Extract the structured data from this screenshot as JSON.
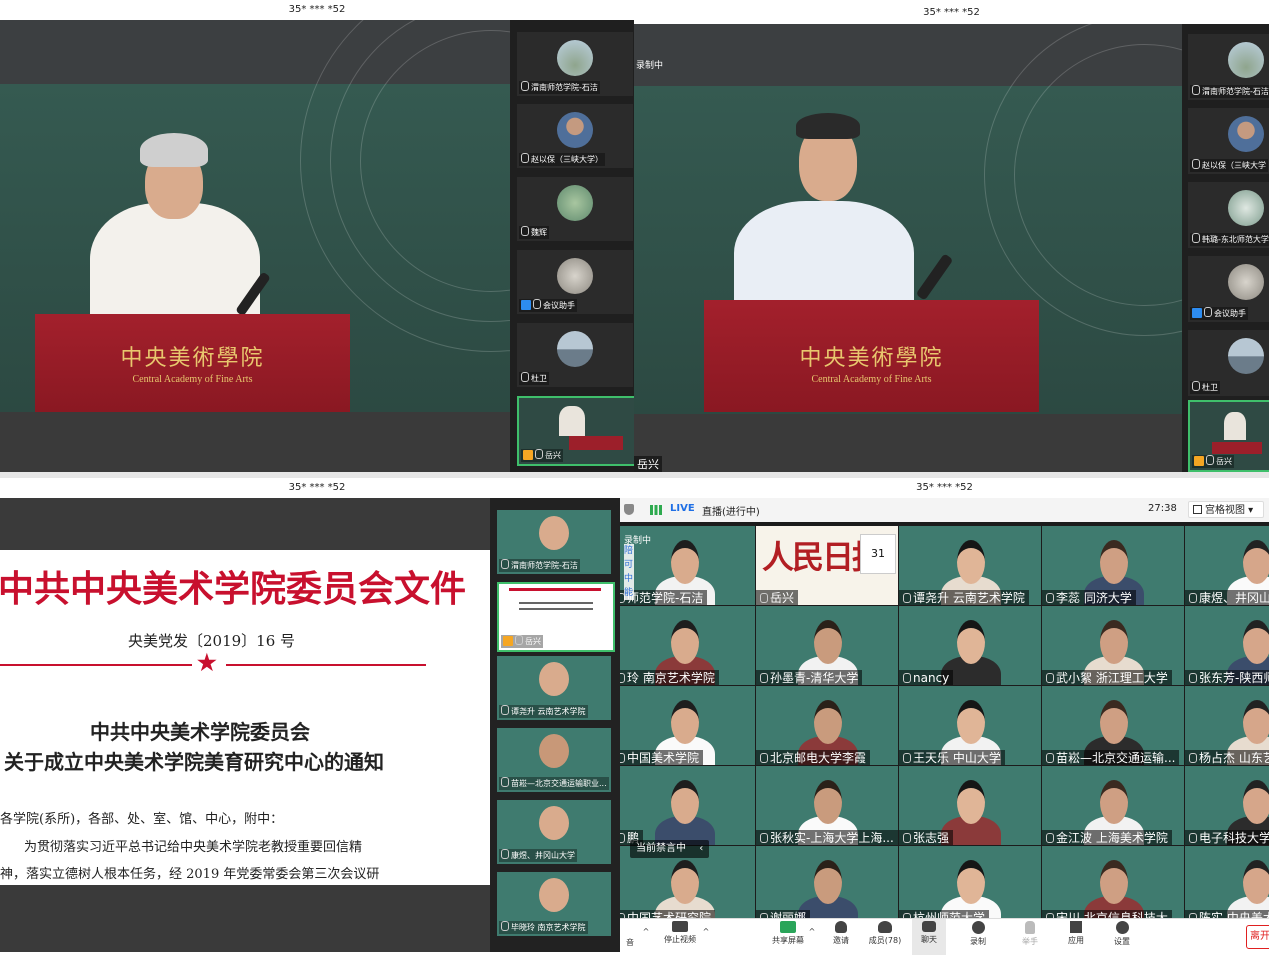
{
  "cap_masked": "35* *** *52",
  "q1": {
    "podium_cn": "中央美術學院",
    "podium_en": "Central Academy of Fine Arts",
    "participants": [
      {
        "label": "渭南师范学院-石洁",
        "avatar": "landscape"
      },
      {
        "label": "赵以保（三峡大学）",
        "avatar": "person"
      },
      {
        "label": "魏辉",
        "avatar": "painting"
      },
      {
        "label": "会议助手",
        "avatar": "rocks",
        "host": true
      },
      {
        "label": "杜卫",
        "avatar": "lake"
      },
      {
        "label": "岳兴",
        "avatar": "stage",
        "host": true
      }
    ]
  },
  "q2": {
    "rec_label": "录制中",
    "speaker_name": "岳兴",
    "podium_cn": "中央美術學院",
    "podium_en": "Central Academy of Fine Arts",
    "participants": [
      {
        "label": "渭南师范学院-石洁"
      },
      {
        "label": "赵以保（三峡大学"
      },
      {
        "label": "韩璐-东北师范大学"
      },
      {
        "label": "会议助手"
      },
      {
        "label": "杜卫"
      },
      {
        "label": "岳兴"
      }
    ]
  },
  "q3": {
    "doc_title": "中共中央美术学院委员会文件",
    "doc_number": "央美党发〔2019〕16 号",
    "doc_heading1": "中共中央美术学院委员会",
    "doc_heading2": "关于成立中央美术学院美育研究中心的通知",
    "doc_body1": "各学院(系所)，各部、处、室、馆、中心，附中：",
    "doc_body2": "为贯彻落实习近平总书记给中央美术学院老教授重要回信精",
    "doc_body3": "神，落实立德树人根本任务，经 2019 年党委常委会第三次会议研",
    "participants": [
      {
        "label": "渭南师范学院-石洁"
      },
      {
        "label": "岳兴"
      },
      {
        "label": "谭尧升 云南艺术学院"
      },
      {
        "label": "苗崧—北京交通运输职业..."
      },
      {
        "label": "康煜、井冈山大学"
      },
      {
        "label": "毕晓玲 南京艺术学院"
      }
    ]
  },
  "q4": {
    "live_badge": "LIVE",
    "live_status": "直播(进行中)",
    "timer": "27:38",
    "view_mode": "宫格视图",
    "rec_label": "录制中",
    "mute_notice": "当前禁言中",
    "side_chars": [
      "陪",
      "可",
      "中",
      "能"
    ],
    "tiles": [
      "师范学院-石洁",
      "岳兴",
      "谭尧升 云南艺术学院",
      "李蕊 同济大学",
      "康煜、井冈山大",
      "玲 南京艺术学院",
      "孙墨青-清华大学",
      "nancy",
      "武小絮 浙江理工大学",
      "张东芳-陕西师范",
      "中国美术学院",
      "北京邮电大学李霞",
      "王天乐 中山大学",
      "苗崧—北京交通运输...",
      "杨占杰 山东艺术",
      "鹏",
      "张秋实-上海大学上海...",
      "张志强",
      "金江波 上海美术学院",
      "电子科技大学 刘",
      "中国艺术研究院",
      "谢丽娜",
      "杭州师范大学",
      "宋川 北京信息科技大",
      "陈实 中央美术"
    ],
    "newspaper_name": "人民日报",
    "newspaper_date": "31",
    "toolbar": {
      "mute_label": "音",
      "video_label": "停止视频",
      "share_label": "共享屏幕",
      "invite_label": "邀请",
      "members_label": "成员(78)",
      "chat_label": "聊天",
      "record_label": "录制",
      "hand_label": "举手",
      "apps_label": "应用",
      "settings_label": "设置",
      "leave_label": "离开"
    }
  },
  "colors": {
    "wall": "#2f4a44",
    "podium": "#a3202c",
    "podium_text": "#e8c76e",
    "doc_red": "#c8102e",
    "tile_green": "#3f7b6f",
    "live_blue": "#1f6fe5"
  }
}
